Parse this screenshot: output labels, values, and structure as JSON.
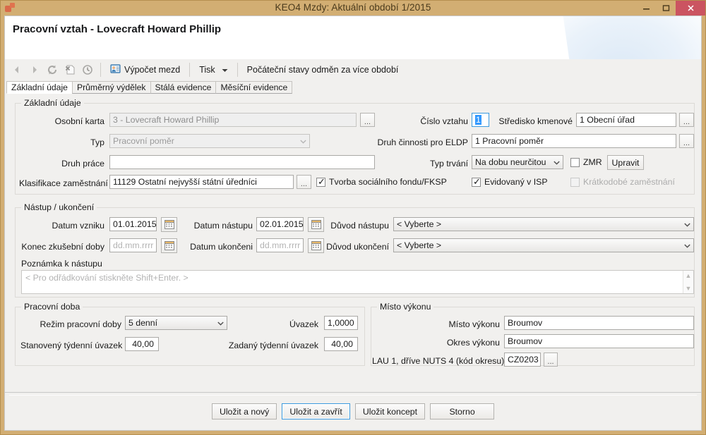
{
  "window": {
    "title": "KEO4 Mzdy: Aktuální období 1/2015",
    "app_icon": "app-logo-icon",
    "minimize": "minimize-icon",
    "maximize": "maximize-icon",
    "close": "close-icon",
    "titlebar_color": "#d2ae73",
    "close_color": "#cb5461"
  },
  "header": {
    "title": "Pracovní vztah - Lovecraft Howard Phillip"
  },
  "toolbar": {
    "back": "back-arrow-icon",
    "forward": "forward-arrow-icon",
    "refresh": "refresh-icon",
    "delete": "delete-record-icon",
    "history": "history-clock-icon",
    "payroll_label": "Výpočet mezd",
    "payroll_icon": "payroll-person-icon",
    "print_label": "Tisk",
    "print_caret": "chevron-down-icon",
    "initial_states_label": "Počáteční stavy odměn za více období"
  },
  "tabs": [
    {
      "label": "Základní údaje",
      "active": true
    },
    {
      "label": "Průměrný výdělek",
      "active": false
    },
    {
      "label": "Stálá evidence",
      "active": false
    },
    {
      "label": "Měsíční evidence",
      "active": false
    }
  ],
  "basic_group": {
    "title": "Základní údaje",
    "personal_card_label": "Osobní karta",
    "personal_card_value": "3 - Lovecraft Howard Phillip",
    "personal_card_ellipsis": "...",
    "type_label": "Typ",
    "type_value": "Pracovní poměr",
    "work_kind_label": "Druh práce",
    "work_kind_value": "",
    "classification_label": "Klasifikace zaměstnání",
    "classification_value": "11129 Ostatní nejvyšší státní úředníci",
    "classification_ellipsis": "...",
    "social_fund_label": "Tvorba sociálního fondu/FKSP",
    "social_fund_checked": true,
    "relation_number_label": "Číslo vztahu",
    "relation_number_value": "1",
    "center_label": "Středisko kmenové",
    "center_value": "1 Obecní úřad",
    "center_ellipsis": "...",
    "eldp_label": "Druh činnosti pro ELDP",
    "eldp_value": "1 Pracovní poměr",
    "eldp_ellipsis": "...",
    "duration_label": "Typ trvání",
    "duration_value": "Na dobu neurčitou",
    "zmr_label": "ZMR",
    "zmr_checked": false,
    "edit_button": "Upravit",
    "isp_label": "Evidovaný v ISP",
    "isp_checked": true,
    "short_term_label": "Krátkodobé zaměstnání",
    "short_term_checked": false
  },
  "entry_group": {
    "title": "Nástup / ukončení",
    "origin_date_label": "Datum vzniku",
    "origin_date_value": "01.01.2015",
    "entry_date_label": "Datum nástupu",
    "entry_date_value": "02.01.2015",
    "entry_reason_label": "Důvod nástupu",
    "entry_reason_value": "< Vyberte >",
    "probation_end_label": "Konec zkušební doby",
    "probation_end_placeholder": "dd.mm.rrrr",
    "end_date_label": "Datum ukončeni",
    "end_date_placeholder": "dd.mm.rrrr",
    "end_reason_label": "Důvod ukončení",
    "end_reason_value": "< Vyberte >",
    "calendar_icon": "calendar-icon",
    "note_label": "Poznámka k nástupu",
    "note_placeholder": "< Pro odřádkování stiskněte Shift+Enter. >"
  },
  "worktime_group": {
    "title": "Pracovní doba",
    "regime_label": "Režim pracovní doby",
    "regime_value": "5 denní",
    "fte_label": "Úvazek",
    "fte_value": "1,0000",
    "weekly_set_label": "Stanovený týdenní úvazek",
    "weekly_set_value": "40,00",
    "weekly_entered_label": "Zadaný týdenní úvazek",
    "weekly_entered_value": "40,00"
  },
  "place_group": {
    "title": "Místo výkonu",
    "place_label": "Místo výkonu",
    "place_value": "Broumov",
    "district_label": "Okres výkonu",
    "district_value": "Broumov",
    "lau_label": "LAU 1, dříve NUTS 4 (kód okresu)",
    "lau_value": "CZ0203",
    "lau_ellipsis": "..."
  },
  "footer": {
    "save_new": "Uložit a nový",
    "save_close": "Uložit a zavřít",
    "save_draft": "Uložit koncept",
    "cancel": "Storno"
  }
}
